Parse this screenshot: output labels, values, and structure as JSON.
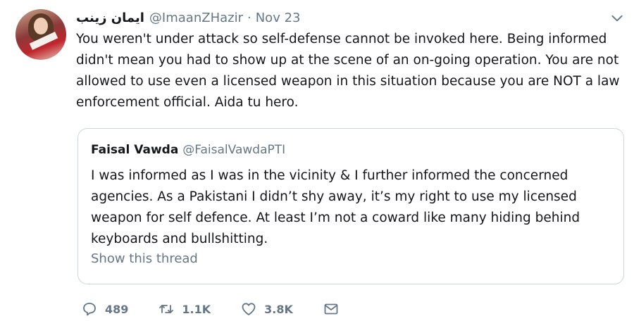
{
  "tweet": {
    "display_name": "ايمان زينب",
    "handle": "@ImaanZHazir",
    "separator": "·",
    "date": "Nov 23",
    "text": "You weren't under attack so self-defense cannot be invoked here. Being informed didn't mean you had to show up at the scene of an on-going operation. You are not allowed to use even a licensed weapon in this situation because you are NOT a law enforcement official. Aida tu hero.",
    "avatar_icon": "profile-photo",
    "menu_icon": "chevron-down-icon"
  },
  "quoted": {
    "display_name": "Faisal Vawda",
    "handle": "@FaisalVawdaPTI",
    "text": "I was informed as I was in the vicinity & I further informed the concerned agencies. As a Pakistani I didn’t shy away, it’s my right to use my licensed weapon for self defence. At least I’m not a coward like many hiding behind keyboards and bullshitting.",
    "show_thread": "Show this thread"
  },
  "actions": {
    "replies": "489",
    "retweets": "1.1K",
    "likes": "3.8K",
    "icons": [
      "reply-icon",
      "retweet-icon",
      "like-icon",
      "message-icon"
    ]
  },
  "colors": {
    "text": "#14171a",
    "secondary": "#657786",
    "border": "#ccd6dd"
  }
}
